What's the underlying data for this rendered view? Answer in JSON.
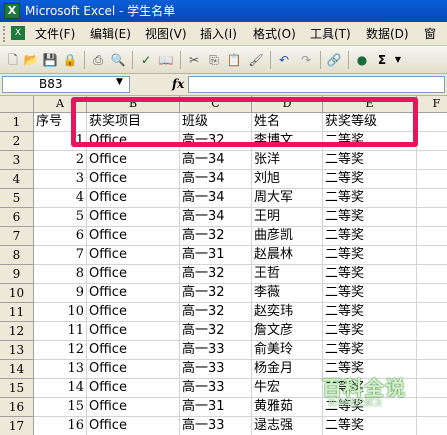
{
  "window": {
    "title": "Microsoft Excel - 学生名单"
  },
  "menu": [
    "文件(F)",
    "编辑(E)",
    "视图(V)",
    "插入(I)",
    "格式(O)",
    "工具(T)",
    "数据(D)",
    "窗"
  ],
  "name_box": "B83",
  "fx_label": "fx",
  "columns": [
    "A",
    "B",
    "C",
    "D",
    "E",
    "F"
  ],
  "rows": [
    [
      "序号",
      "获奖项目",
      "班级",
      "姓名",
      "获奖等级"
    ],
    [
      "1",
      "Office",
      "高一32",
      "李博文",
      "二等奖"
    ],
    [
      "2",
      "Office",
      "高一34",
      "张洋",
      "二等奖"
    ],
    [
      "3",
      "Office",
      "高一34",
      "刘旭",
      "二等奖"
    ],
    [
      "4",
      "Office",
      "高一34",
      "周大军",
      "二等奖"
    ],
    [
      "5",
      "Office",
      "高一34",
      "王明",
      "二等奖"
    ],
    [
      "6",
      "Office",
      "高一32",
      "曲彦凯",
      "二等奖"
    ],
    [
      "7",
      "Office",
      "高一31",
      "赵晨林",
      "二等奖"
    ],
    [
      "8",
      "Office",
      "高一32",
      "王哲",
      "二等奖"
    ],
    [
      "9",
      "Office",
      "高一32",
      "李薇",
      "二等奖"
    ],
    [
      "10",
      "Office",
      "高一32",
      "赵奕玮",
      "二等奖"
    ],
    [
      "11",
      "Office",
      "高一32",
      "詹文彦",
      "二等奖"
    ],
    [
      "12",
      "Office",
      "高一33",
      "俞美玲",
      "二等奖"
    ],
    [
      "13",
      "Office",
      "高一33",
      "杨金月",
      "二等奖"
    ],
    [
      "14",
      "Office",
      "高一33",
      "牛宏",
      "二等奖"
    ],
    [
      "15",
      "Office",
      "高一31",
      "黄雅茹",
      "二等奖"
    ],
    [
      "16",
      "Office",
      "高一33",
      "逯志强",
      "二等奖"
    ]
  ],
  "watermark": {
    "logo": "百科全说",
    "sub": "助你轻松解决"
  }
}
